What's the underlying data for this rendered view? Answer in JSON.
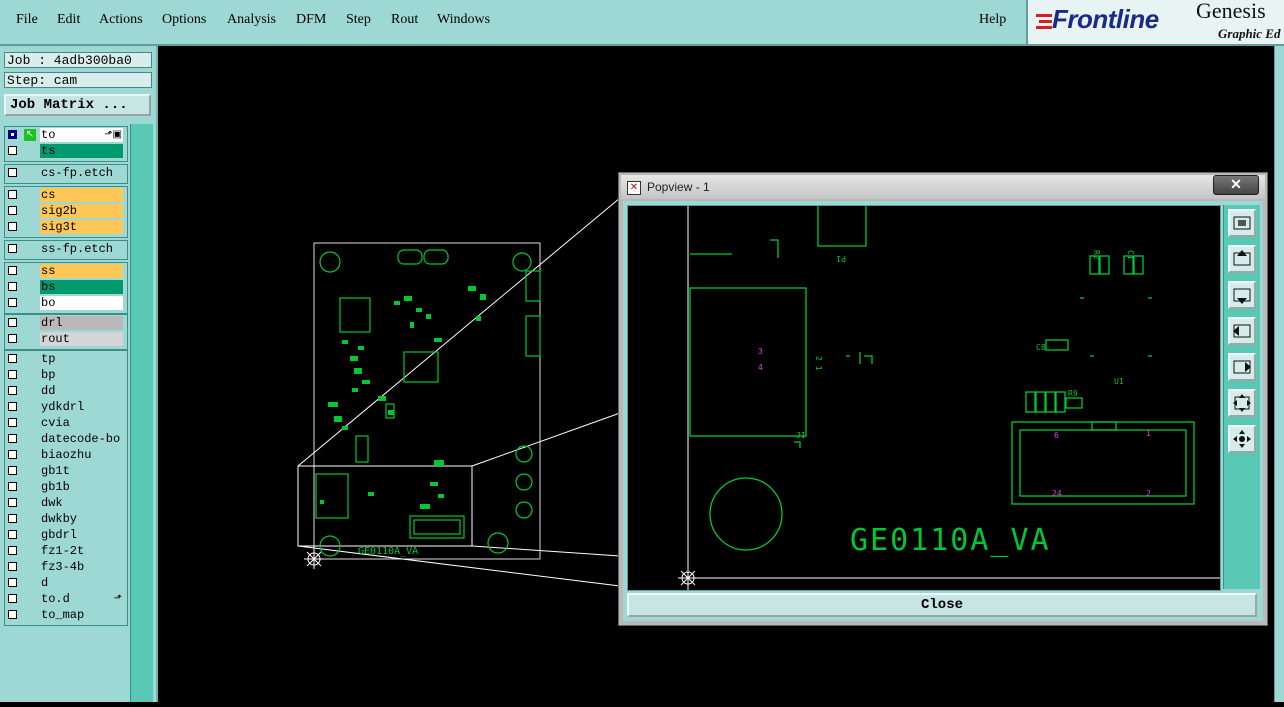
{
  "menu": {
    "items": [
      "File",
      "Edit",
      "Actions",
      "Options",
      "Analysis",
      "DFM",
      "Step",
      "Rout",
      "Windows"
    ],
    "help": "Help"
  },
  "logo": {
    "brand": "Frontline",
    "product": "Genesis",
    "subtitle": "Graphic Ed"
  },
  "job": {
    "job_label": "Job : 4adb300ba0",
    "step_label": "Step: cam",
    "matrix_button": "Job Matrix ..."
  },
  "layers": [
    {
      "name": "to",
      "color": "#ffffff",
      "active": true,
      "mark": "⬏▣"
    },
    {
      "name": "ts",
      "color": "#009a6e"
    },
    {
      "name": "cs-fp.etch",
      "color": "#9dd8d4"
    },
    {
      "name": "cs",
      "color": "#ffc658"
    },
    {
      "name": "sig2b",
      "color": "#ffc658"
    },
    {
      "name": "sig3t",
      "color": "#ffc658"
    },
    {
      "name": "ss-fp.etch",
      "color": "#9dd8d4"
    },
    {
      "name": "ss",
      "color": "#ffc658"
    },
    {
      "name": "bs",
      "color": "#009a6e"
    },
    {
      "name": "bo",
      "color": "#ffffff"
    },
    {
      "name": "drl",
      "color": "#b9b9b9"
    },
    {
      "name": "rout",
      "color": "#d5d5d5"
    },
    {
      "name": "tp",
      "color": "#9dd8d4"
    },
    {
      "name": "bp",
      "color": "#9dd8d4"
    },
    {
      "name": "dd",
      "color": "#9dd8d4"
    },
    {
      "name": "ydkdrl",
      "color": "#9dd8d4"
    },
    {
      "name": "cvia",
      "color": "#9dd8d4"
    },
    {
      "name": "datecode-bo",
      "color": "#9dd8d4"
    },
    {
      "name": "biaozhu",
      "color": "#9dd8d4"
    },
    {
      "name": "gb1t",
      "color": "#9dd8d4"
    },
    {
      "name": "gb1b",
      "color": "#9dd8d4"
    },
    {
      "name": "dwk",
      "color": "#9dd8d4"
    },
    {
      "name": "dwkby",
      "color": "#9dd8d4"
    },
    {
      "name": "gbdrl",
      "color": "#9dd8d4"
    },
    {
      "name": "fz1-2t",
      "color": "#9dd8d4"
    },
    {
      "name": "fz3-4b",
      "color": "#9dd8d4"
    },
    {
      "name": "d",
      "color": "#9dd8d4"
    },
    {
      "name": "to.d",
      "color": "#9dd8d4",
      "mark": "⬏"
    },
    {
      "name": "to_map",
      "color": "#9dd8d4"
    }
  ],
  "popview": {
    "title": "Popview - 1",
    "close_x": "✕",
    "close_button": "Close",
    "board_text": "GE0110A_VA",
    "tools": [
      "zoom-fit-icon",
      "pan-up-icon",
      "pan-down-icon",
      "pan-left-icon",
      "pan-right-icon",
      "zoom-out-icon",
      "zoom-in-icon"
    ]
  },
  "board_label": "GE0110A_VA",
  "colors": {
    "panel": "#9dd8d4",
    "trace": "#00c832",
    "pin_label": "#e040e0"
  }
}
